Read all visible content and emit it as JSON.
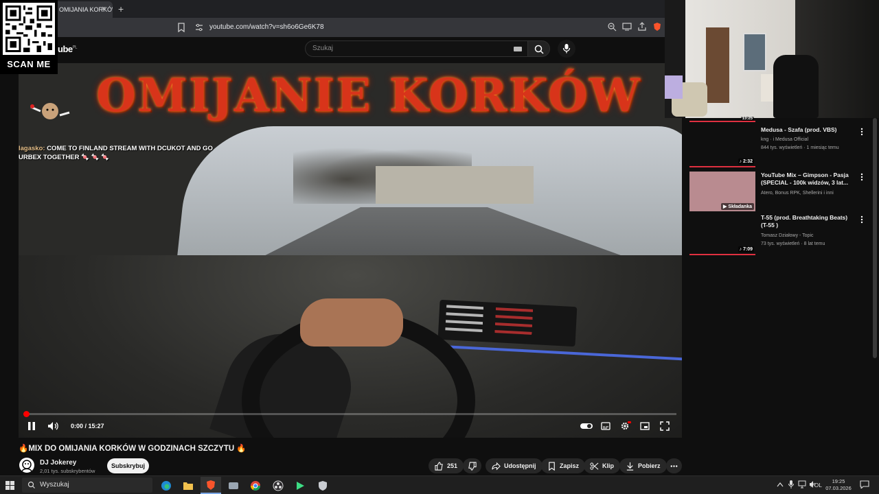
{
  "browser": {
    "tab_title": "OMIJANIA KORKÓW",
    "tab_close": "×",
    "new_tab": "+",
    "url": "youtube.com/watch?v=sh6o6Ge6K78"
  },
  "youtube_header": {
    "logo_text": "ube",
    "logo_region": "PL",
    "search_placeholder": "Szukaj"
  },
  "overlay": {
    "qr_label": "SCAN ME"
  },
  "video": {
    "banner_text": "OMIJANIE KORKÓW",
    "chat_user": "lagasko:",
    "chat_message": "COME TO FINLAND STREAM WITH DCUKOT AND GO URBEX TOGETHER 🍬 🍬 🍬",
    "current_time": "0:00",
    "duration": "15:27",
    "timecode": "0:00 / 15:27",
    "progress_fraction": 0.003,
    "title": "🔥MIX DO OMIJANIA KORKÓW W GODZINACH SZCZYTU 🔥"
  },
  "channel": {
    "name": "DJ Jokerey",
    "subscribers": "2,01 tys. subskrybentów",
    "subscribe_label": "Subskrybuj"
  },
  "actions": {
    "likes": "251",
    "share": "Udostępnij",
    "save": "Zapisz",
    "clip": "Klip",
    "download": "Pobierz"
  },
  "recommendations": [
    {
      "title": "Medusa - Szafa (prod. VBS)",
      "channel": "kng · i Medusa Official",
      "meta": "844 tys. wyświetleń · 1 miesiąc temu",
      "duration": "2:32"
    },
    {
      "title": "YouTube Mix – Gimpson - Pasja (SPECIAL - 100k widzów, 3 lat...",
      "channel": "Atero, Bonus RPK, Shellerini i inni",
      "badge": "Składanka"
    },
    {
      "title": "T-55 (prod. Breathtaking Beats) (T-55 )",
      "channel": "Tomasz Działowy - Topic",
      "meta": "73 tys. wyświetleń · 8 lat temu",
      "duration": "7:09"
    }
  ],
  "prev_duration": "13:25",
  "taskbar": {
    "search_label": "Wyszukaj",
    "lang": "POL",
    "time": "19:25",
    "date": "07.03.2026"
  },
  "colors": {
    "accent_red": "#ff0000",
    "banner_red": "#d8341a",
    "background": "#0f0f0f"
  }
}
